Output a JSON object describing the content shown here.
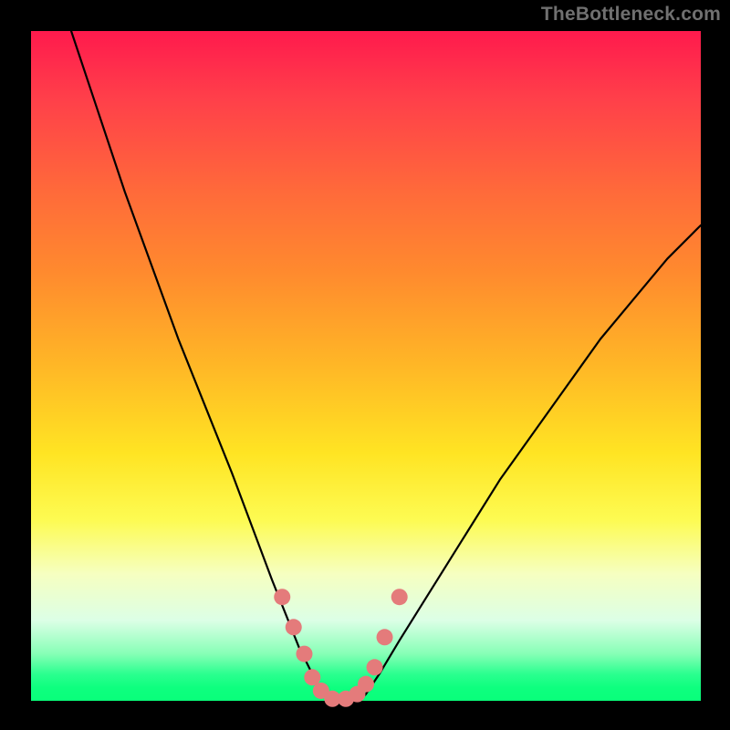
{
  "watermark": "TheBottleneck.com",
  "chart_data": {
    "type": "line",
    "title": "",
    "xlabel": "",
    "ylabel": "",
    "xlim": [
      0,
      100
    ],
    "ylim": [
      0,
      100
    ],
    "grid": false,
    "legend": false,
    "series": [
      {
        "name": "bottleneck-curve",
        "x": [
          6,
          10,
          14,
          18,
          22,
          26,
          30,
          33,
          36,
          38,
          40,
          42,
          43,
          45,
          47,
          49,
          50,
          52,
          55,
          60,
          65,
          70,
          75,
          80,
          85,
          90,
          95,
          100
        ],
        "values": [
          100,
          88,
          76,
          65,
          54,
          44,
          34,
          26,
          18,
          13,
          8,
          4,
          1.5,
          0,
          0,
          0,
          1,
          4,
          9,
          17,
          25,
          33,
          40,
          47,
          54,
          60,
          66,
          71
        ]
      }
    ],
    "markers": {
      "name": "highlight-dots",
      "color": "#e47b7b",
      "radius_px": 9,
      "x": [
        37.5,
        39.2,
        40.8,
        42.0,
        43.3,
        45.0,
        47.0,
        48.7,
        50.0,
        51.3,
        52.8,
        55.0
      ],
      "values": [
        15.5,
        11.0,
        7.0,
        3.5,
        1.5,
        0.3,
        0.3,
        1.0,
        2.5,
        5.0,
        9.5,
        15.5
      ]
    },
    "gradient_stops": [
      {
        "pos": 0.0,
        "color": "#ff1a4d"
      },
      {
        "pos": 0.24,
        "color": "#ff6a3a"
      },
      {
        "pos": 0.5,
        "color": "#ffb726"
      },
      {
        "pos": 0.73,
        "color": "#fdfb52"
      },
      {
        "pos": 0.88,
        "color": "#dcffe6"
      },
      {
        "pos": 1.0,
        "color": "#09ff7a"
      }
    ]
  }
}
